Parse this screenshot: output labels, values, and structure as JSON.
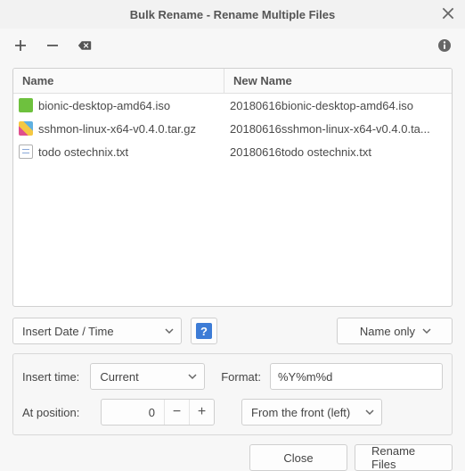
{
  "window": {
    "title": "Bulk Rename - Rename Multiple Files"
  },
  "columns": {
    "name": "Name",
    "newname": "New Name"
  },
  "files": [
    {
      "icon": "iso",
      "name": "bionic-desktop-amd64.iso",
      "newname": "20180616bionic-desktop-amd64.iso"
    },
    {
      "icon": "archive",
      "name": "sshmon-linux-x64-v0.4.0.tar.gz",
      "newname": "20180616sshmon-linux-x64-v0.4.0.ta..."
    },
    {
      "icon": "txt",
      "name": "todo ostechnix.txt",
      "newname": "20180616todo ostechnix.txt"
    }
  ],
  "mode": {
    "operation": "Insert Date / Time",
    "scope": "Name only"
  },
  "options": {
    "insert_time_label": "Insert time:",
    "insert_time_value": "Current",
    "format_label": "Format:",
    "format_value": "%Y%m%d",
    "position_label": "At position:",
    "position_value": "0",
    "from_value": "From the front (left)"
  },
  "buttons": {
    "close": "Close",
    "rename": "Rename Files"
  }
}
